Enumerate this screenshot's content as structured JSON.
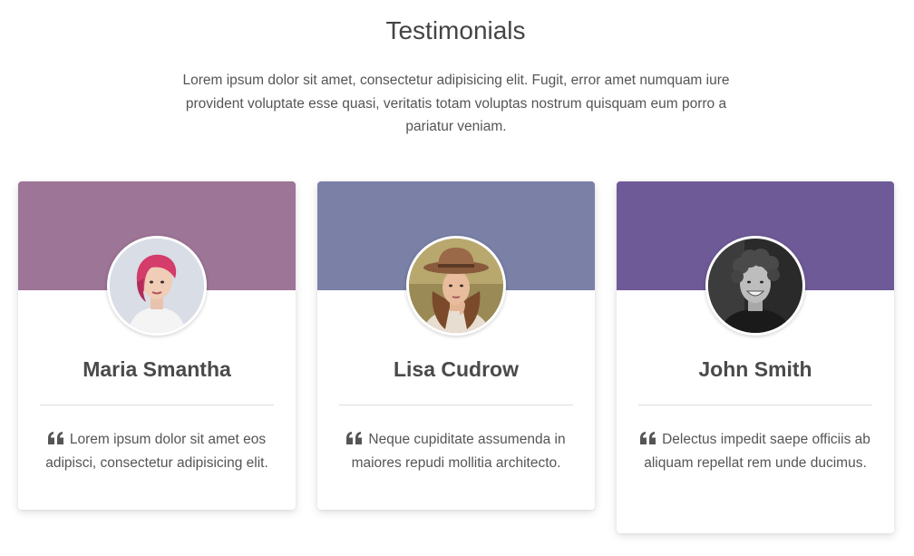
{
  "section": {
    "title": "Testimonials",
    "intro": "Lorem ipsum dolor sit amet, consectetur adipisicing elit. Fugit, error amet numquam iure provident voluptate esse quasi, veritatis totam voluptas nostrum quisquam eum porro a pariatur veniam."
  },
  "testimonials": [
    {
      "name": "Maria Smantha",
      "quote": "Lorem ipsum dolor sit amet eos adipisci, consectetur adipisicing elit.",
      "header_color": "#9d7597",
      "avatar_icon": "woman-pink-hair-avatar"
    },
    {
      "name": "Lisa Cudrow",
      "quote": "Neque cupiditate assumenda in maiores repudi mollitia architecto.",
      "header_color": "#7a80a6",
      "avatar_icon": "woman-hat-avatar"
    },
    {
      "name": "John Smith",
      "quote": "Delectus impedit saepe officiis ab aliquam repellat rem unde ducimus.",
      "header_color": "#6e5a97",
      "avatar_icon": "man-curly-hair-avatar"
    }
  ],
  "icons": {
    "quote": "quote-left-icon"
  }
}
